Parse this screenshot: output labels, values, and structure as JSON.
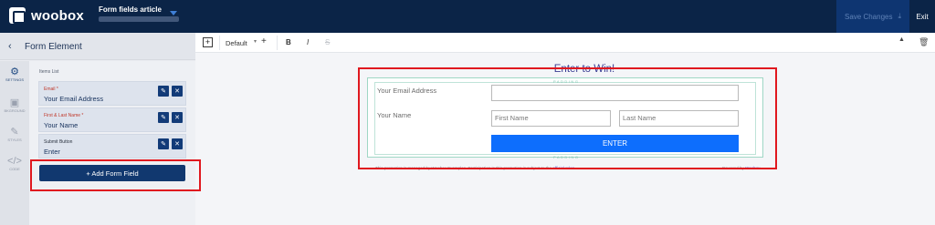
{
  "app": {
    "logo_text": "woobox",
    "document_title": "Form fields article",
    "save_label": "Save Changes",
    "exit_label": "Exit"
  },
  "panel": {
    "title": "Form Element",
    "items_list_label": "Items List",
    "rail": [
      {
        "label": "SETTINGS",
        "icon": "gear-icon"
      },
      {
        "label": "BKGROUND",
        "icon": "image-icon"
      },
      {
        "label": "STYLES",
        "icon": "brush-icon"
      },
      {
        "label": "CODE",
        "icon": "code-icon"
      }
    ],
    "fields": [
      {
        "name": "Email *",
        "value": "Your Email Address"
      },
      {
        "name": "First & Last Name *",
        "value": "Your Name"
      },
      {
        "name": "Submit Button",
        "value": "Enter"
      }
    ],
    "add_field_label": "+ Add Form Field"
  },
  "toolbar": {
    "style_value": "Default",
    "bold": "B",
    "italic": "I",
    "strike": "S"
  },
  "preview": {
    "title": "Enter to Win!",
    "padding_label": "PADDING",
    "email_label": "Your Email Address",
    "name_label": "Your Name",
    "first_placeholder": "First Name",
    "last_placeholder": "Last Name",
    "enter_label": "ENTER",
    "footer_text": "This promotion is managed by Woobox Examples. Participation in this promotion is subject to the",
    "footer_link": "official rules.",
    "powered_by": "Powered by",
    "powered_brand": "Woobox"
  },
  "colors": {
    "header_bg": "#0b2447",
    "accent_blue": "#0d6efd",
    "highlight_red": "#e0181f"
  }
}
